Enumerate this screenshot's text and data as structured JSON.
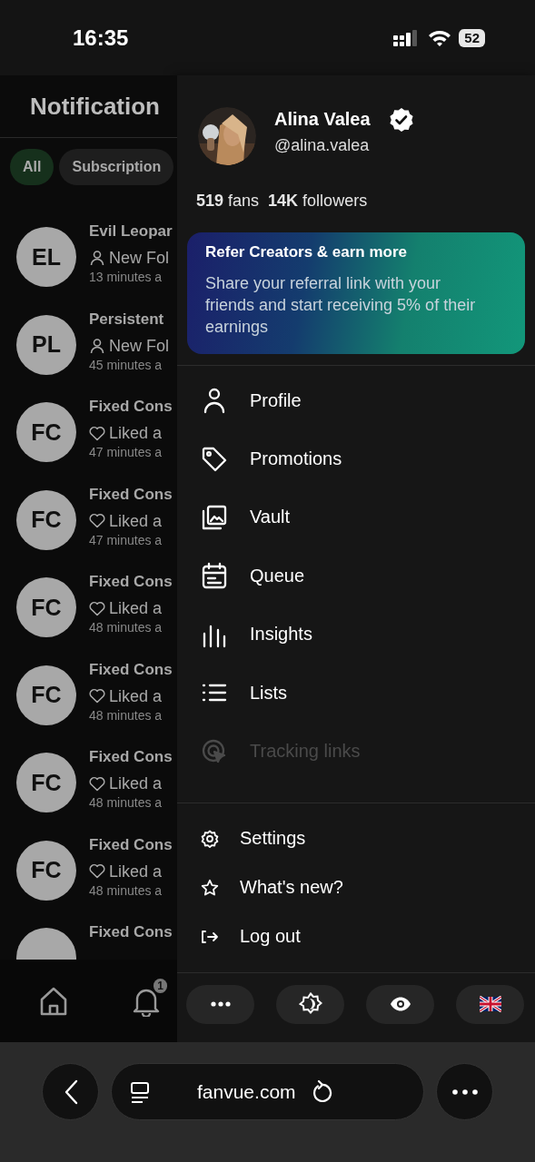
{
  "status_bar": {
    "time": "16:35",
    "battery": "52"
  },
  "notifications": {
    "title": "Notification",
    "filters": [
      {
        "label": "All",
        "selected": true
      },
      {
        "label": "Subscription",
        "selected": false
      }
    ],
    "items": [
      {
        "initials": "EL",
        "name": "Evil Leopar",
        "kind": "follow",
        "action": "New Fol",
        "time": "13 minutes a"
      },
      {
        "initials": "PL",
        "name": "Persistent",
        "kind": "follow",
        "action": "New Fol",
        "time": "45 minutes a"
      },
      {
        "initials": "FC",
        "name": "Fixed Cons",
        "kind": "like",
        "action": "Liked a",
        "time": "47 minutes a"
      },
      {
        "initials": "FC",
        "name": "Fixed Cons",
        "kind": "like",
        "action": "Liked a",
        "time": "47 minutes a"
      },
      {
        "initials": "FC",
        "name": "Fixed Cons",
        "kind": "like",
        "action": "Liked a",
        "time": "48 minutes a"
      },
      {
        "initials": "FC",
        "name": "Fixed Cons",
        "kind": "like",
        "action": "Liked a",
        "time": "48 minutes a"
      },
      {
        "initials": "FC",
        "name": "Fixed Cons",
        "kind": "like",
        "action": "Liked a",
        "time": "48 minutes a"
      },
      {
        "initials": "FC",
        "name": "Fixed Cons",
        "kind": "like",
        "action": "Liked a",
        "time": "48 minutes a"
      },
      {
        "name": "Fixed Cons"
      }
    ],
    "nav_badge": "1"
  },
  "drawer": {
    "profile": {
      "name": "Alina Valea",
      "handle": "@alina.valea",
      "verified": true
    },
    "stats": [
      "**519** fans",
      "**14K** followers"
    ],
    "referral": {
      "title": "Refer Creators & earn more",
      "text": "Share your referral link with your friends and start receiving 5% of their earnings"
    },
    "menu": [
      {
        "label": "Profile",
        "disabled": false
      },
      {
        "label": "Promotions",
        "disabled": false
      },
      {
        "label": "Vault",
        "disabled": false
      },
      {
        "label": "Queue",
        "disabled": false
      },
      {
        "label": "Insights",
        "disabled": false
      },
      {
        "label": "Lists",
        "disabled": false
      },
      {
        "label": "Tracking links",
        "disabled": true
      }
    ],
    "secondary": [
      {
        "label": "Settings"
      },
      {
        "label": "What's new?"
      },
      {
        "label": "Log out"
      }
    ]
  },
  "browser": {
    "url": "fanvue.com"
  }
}
